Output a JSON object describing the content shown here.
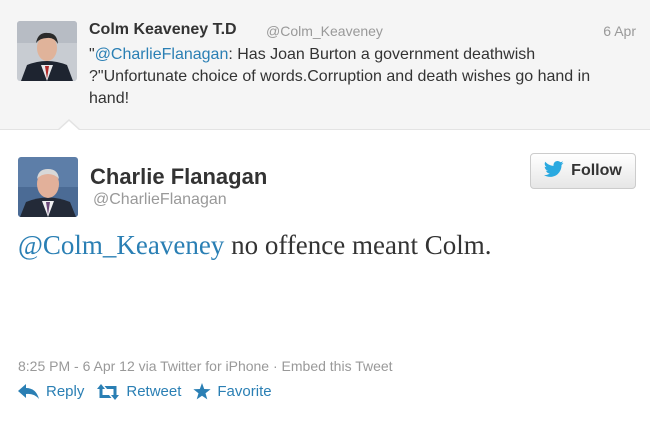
{
  "parent_tweet": {
    "name": "Colm Keaveney T.D",
    "handle": "@Colm_Keaveney",
    "date": "6 Apr",
    "text_mention": "@CharlieFlanagan",
    "text_prefix": "\"",
    "text_body": ": Has Joan Burton a government deathwish ?\"Unfortunate choice of words.Corruption and death wishes go hand in hand!"
  },
  "main_tweet": {
    "name": "Charlie Flanagan",
    "handle": "@CharlieFlanagan",
    "follow_label": "Follow",
    "text_mention": "@Colm_Keaveney",
    "text_body": " no offence meant Colm.",
    "timestamp": "8:25 PM - 6 Apr 12 via Twitter for iPhone",
    "separator": " · ",
    "embed_label": "Embed this Tweet"
  },
  "actions": {
    "reply_label": "Reply",
    "retweet_label": "Retweet",
    "favorite_label": "Favorite"
  },
  "icons": {
    "follow": "twitter-bird-icon",
    "reply": "reply-arrow-icon",
    "retweet": "retweet-icon",
    "favorite": "star-icon"
  },
  "colors": {
    "link": "#2a7fb4",
    "bird": "#2aa9e0",
    "muted": "#999999",
    "parent_bg": "#f5f5f5"
  }
}
